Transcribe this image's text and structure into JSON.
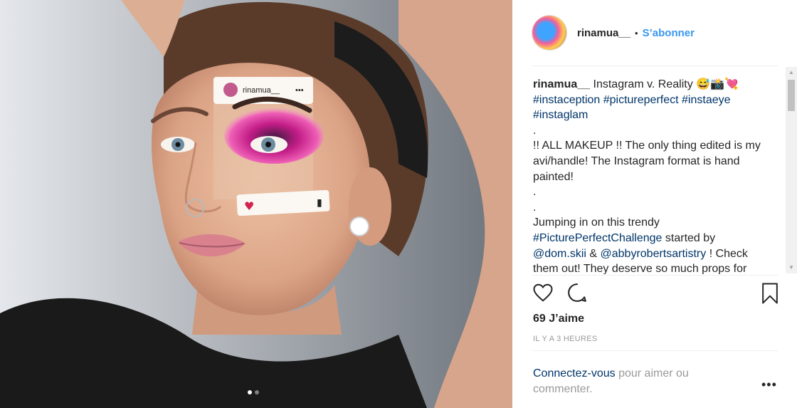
{
  "post": {
    "username": "rinamua__",
    "separator": "•",
    "follow_label": "S’abonner",
    "image": {
      "overlay_username": "rinamua__",
      "overlay_dots": "•••",
      "carousel_count": 2,
      "carousel_active": 1
    },
    "caption": {
      "author": "rinamua__",
      "title": "Instagram v. Reality 😅📸💘",
      "hashtags_line1": "#instaception #pictureperfect #instaeye",
      "hashtags_line2": "#instaglam",
      "dot1": ".",
      "line_makeup": "!! ALL MAKEUP !! The only thing edited is my avi/handle! The Instagram format is hand painted!",
      "dot2": ".",
      "dot3": ".",
      "line_jump": "Jumping in on this trendy",
      "challenge_tag": "#PicturePerfectChallenge",
      "started_by": "started by",
      "mention1": "@dom.skii",
      "amp": "&",
      "mention2": "@abbyrobertsartistry",
      "check": "! Check them out! They deserve so much props for"
    },
    "likes": "69 J’aime",
    "time_ago": "IL Y A 3 HEURES",
    "comment_prompt_link": "Connectez-vous",
    "comment_prompt_rest": "pour aimer ou commenter.",
    "more_label": "•••"
  },
  "icons": {
    "like": "heart-icon",
    "comment": "comment-icon",
    "save": "bookmark-icon",
    "more": "more-options-icon"
  },
  "colors": {
    "link_blue": "#3897f0",
    "hashtag": "#003569",
    "muted": "#999999",
    "text": "#262626"
  }
}
